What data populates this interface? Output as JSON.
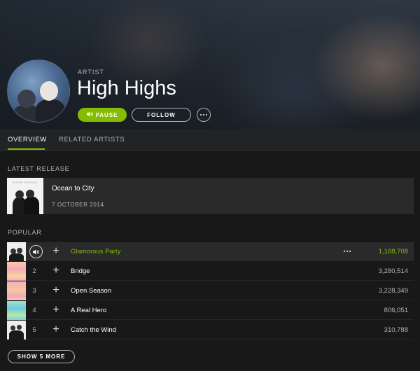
{
  "header": {
    "artist_label": "ARTIST",
    "artist_name": "High Highs",
    "pause_label": "PAUSE",
    "follow_label": "FOLLOW"
  },
  "tabs": [
    {
      "label": "OVERVIEW",
      "active": true
    },
    {
      "label": "RELATED ARTISTS",
      "active": false
    }
  ],
  "latest_release": {
    "section_title": "LATEST RELEASE",
    "art_text": "HIGH HIGHS",
    "title": "Ocean to City",
    "date": "7 OCTOBER 2014"
  },
  "popular": {
    "section_title": "POPULAR",
    "tracks": [
      {
        "num": "1",
        "title": "Glamorous Party",
        "plays": "1,168,708",
        "playing": true
      },
      {
        "num": "2",
        "title": "Bridge",
        "plays": "3,280,514",
        "playing": false
      },
      {
        "num": "3",
        "title": "Open Season",
        "plays": "3,228,349",
        "playing": false
      },
      {
        "num": "4",
        "title": "A Real Hero",
        "plays": "806,051",
        "playing": false
      },
      {
        "num": "5",
        "title": "Catch the Wind",
        "plays": "310,788",
        "playing": false
      }
    ],
    "show_more_label": "SHOW 5 MORE"
  },
  "colors": {
    "accent": "#84bd00",
    "background": "#181818",
    "row_highlight": "#2a2a2a"
  },
  "icons": {
    "pause_button": "speaker-icon",
    "more": "ellipsis-icon",
    "add": "plus-icon"
  }
}
